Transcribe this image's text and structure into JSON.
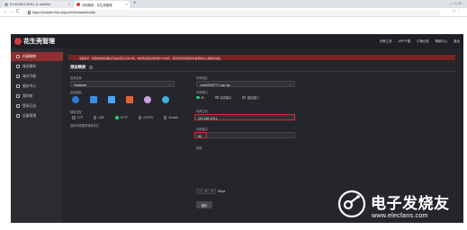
{
  "browser": {
    "tabs": [
      {
        "label": "ET-ACSKU-SRS1-11-msnEmi"
      },
      {
        "label": "内网映射 - 花生壳管理"
      }
    ],
    "new_tab": "+",
    "window_controls": "—   ☐   ✕",
    "url": "https://console.hsk.oray.com/forward/modify",
    "nav_back": "←",
    "nav_forward": "→",
    "nav_reload": "C",
    "addr_right": "☆  ⋮"
  },
  "app": {
    "logo_text": "花生壳管理",
    "top_menu": [
      "诊断工具",
      "APP下载",
      "订单记录",
      "帮助中心",
      "退出"
    ],
    "sidebar": [
      {
        "label": "内网映射",
        "active": true
      },
      {
        "label": "域名解析"
      },
      {
        "label": "域名列表"
      },
      {
        "label": "服务中心"
      },
      {
        "label": "我的账"
      },
      {
        "label": "登录日志"
      },
      {
        "label": "设备管理"
      }
    ],
    "alert_text": "温馨提示：配置映射前请确认已启动花生壳客户端，映射添加后生效需要少许时间，若出现访问问题请查看帮助中心或联系客服。",
    "section_title": "添加映射"
  },
  "form": {
    "type_label": "应用名称",
    "type_value": "Fastbean",
    "app_icons_label": "应用图标",
    "protocol_label": "映射类型",
    "protocols": [
      "TCP",
      "UDP",
      "HTTP",
      "HTTPS",
      "Socks5"
    ],
    "protocol_selected": "HTTP",
    "protocol_note": "选择你需要的映射协议",
    "domain_label": "外网域名",
    "domain_value": "zhv60f330777.vicp.vip",
    "external_port_label": "外网端口",
    "external_port_options": [
      "80",
      "动态端口",
      "固定端口"
    ],
    "external_port_selected": "80",
    "internal_host_label": "内网主机",
    "internal_host_value": "192.168.123.1",
    "internal_port_label": "内网端口",
    "internal_port_value": "80",
    "bandwidth_label": "带宽",
    "bandwidth_value": "1",
    "bandwidth_unit": "Mbps",
    "submit_label": "保存"
  },
  "watermark": {
    "title": "电子发烧友",
    "subtitle": "www.elecfans.com"
  },
  "colors": {
    "accent": "#8f2f2f",
    "highlight_border": "#d33030",
    "radio_on": "#2ecc71"
  }
}
